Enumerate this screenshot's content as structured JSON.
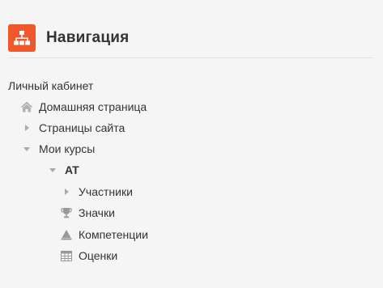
{
  "block": {
    "icon": "sitemap-icon",
    "title": "Навигация"
  },
  "tree": {
    "dashboard": "Личный кабинет",
    "home": {
      "label": "Домашняя страница",
      "icon": "home-icon"
    },
    "site_pages": {
      "label": "Страницы сайта",
      "icon": "triangle-right-icon"
    },
    "my_courses": {
      "label": "Мои курсы",
      "icon": "triangle-down-icon"
    },
    "course": {
      "label": "AT",
      "icon": "triangle-down-icon"
    },
    "participants": {
      "label": "Участники",
      "icon": "triangle-right-icon"
    },
    "badges": {
      "label": "Значки",
      "icon": "trophy-icon"
    },
    "competencies": {
      "label": "Компетенции",
      "icon": "competency-icon"
    },
    "grades": {
      "label": "Оценки",
      "icon": "table-icon"
    }
  },
  "colors": {
    "accent": "#f0572b",
    "text": "#333333",
    "icon_grey": "#aaaaaa",
    "background": "#f5f5f5"
  }
}
